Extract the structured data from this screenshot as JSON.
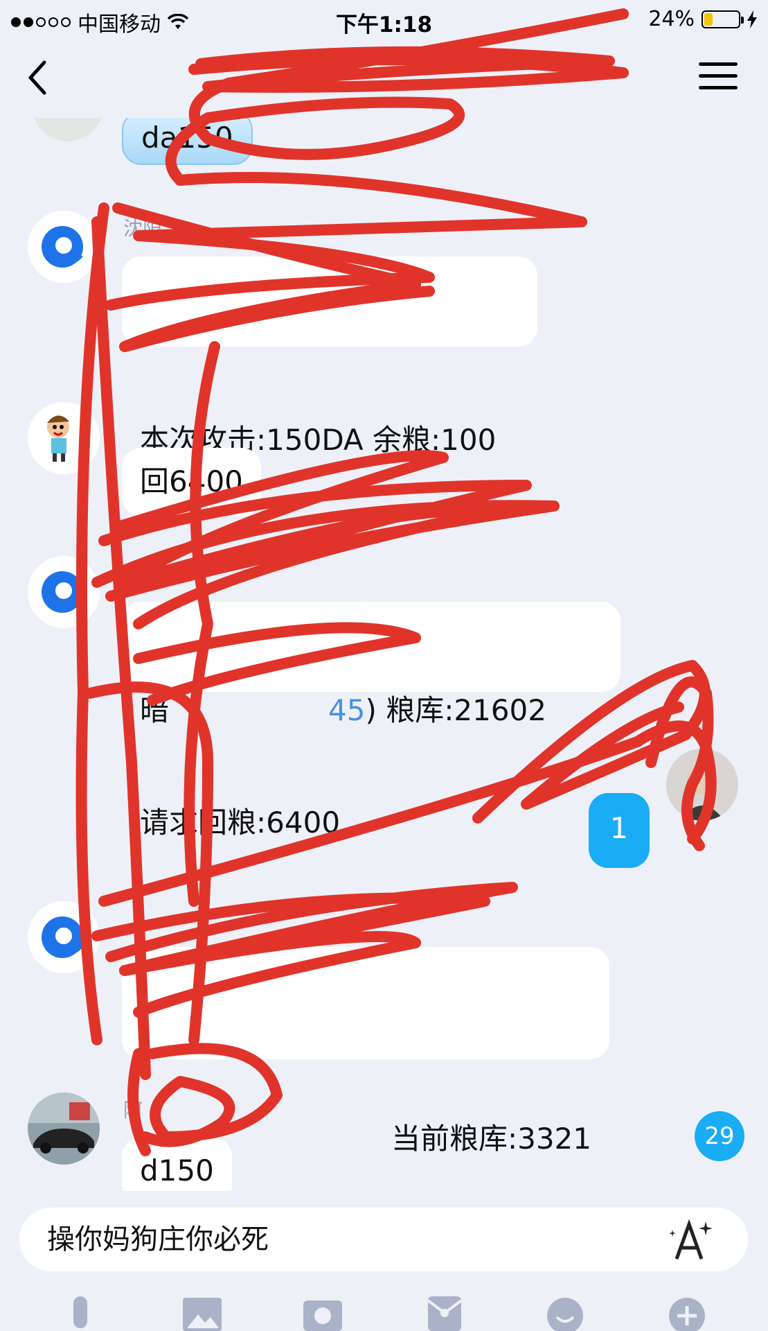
{
  "status_bar": {
    "carrier": "中国移动",
    "time": "下午1:18",
    "battery_percent": "24%",
    "battery_level": 0.24
  },
  "nav": {
    "title": "",
    "subtitle": ""
  },
  "messages": [
    {
      "type": "text",
      "text": "da150"
    },
    {
      "type": "text",
      "sender": "沈阳",
      "line1": "",
      "line2": "本次攻击:150DA 余粮:100"
    },
    {
      "type": "text",
      "text": "回6400"
    },
    {
      "type": "text",
      "line1_prefix": "暗",
      "line1_link": "45",
      "line1_suffix": ") 粮库:21602",
      "line2": "请求回粮:6400"
    },
    {
      "type": "text",
      "text": "1"
    },
    {
      "type": "text",
      "line1": "",
      "line2": "当前粮库:3321"
    },
    {
      "type": "text",
      "sender": "阿",
      "text": "d150"
    }
  ],
  "unread_count": "29",
  "input": {
    "value": "操你妈狗庄你必死"
  },
  "icons": {
    "back": "chevron-left-icon",
    "menu": "hamburger-menu-icon",
    "font": "font-style-icon",
    "toolbar": [
      "microphone-icon",
      "image-icon",
      "camera-icon",
      "red-packet-icon",
      "emoji-icon",
      "plus-icon"
    ]
  },
  "colors": {
    "background": "#eef0f7",
    "bubble": "#ffffff",
    "accent_blue": "#1aacf5",
    "scribble_red": "#e0342b"
  }
}
